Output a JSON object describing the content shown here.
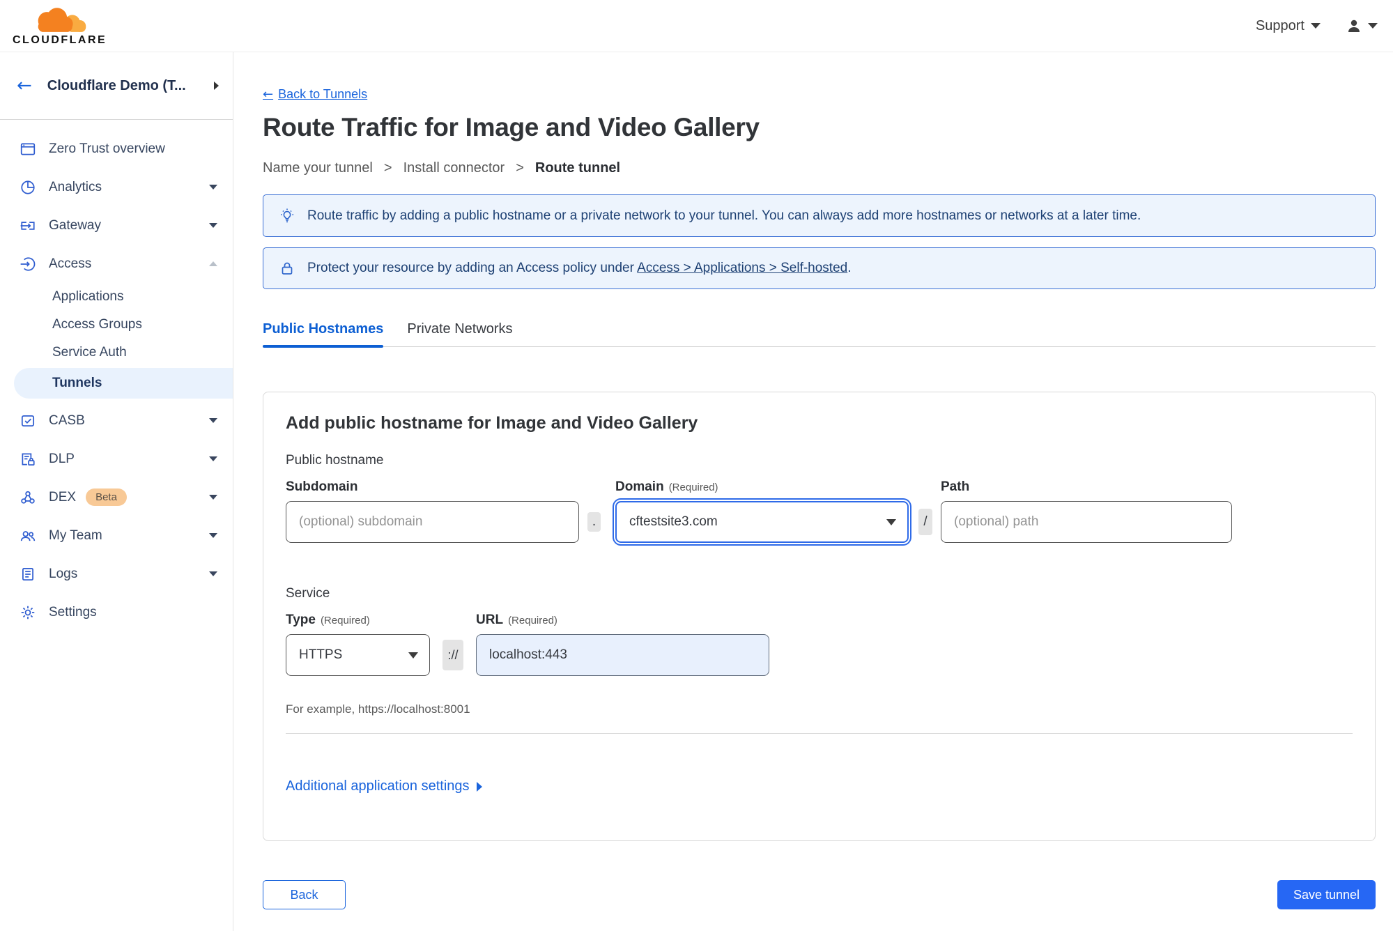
{
  "logo": {
    "brand": "CLOUDFLARE"
  },
  "header": {
    "support_label": "Support"
  },
  "colors": {
    "accent": "#1a64dc",
    "tab_active": "#0d5fd3",
    "save_button": "#2667f4",
    "banner_bg": "#edf4fd",
    "banner_border": "#3c70d5",
    "banner_text": "#1d4073",
    "selected_item_bg": "#e9f2fd",
    "beta_bg": "#f8c996",
    "beta_text": "#5b5147",
    "brand_orange": "#f48120",
    "brand_orange_light": "#f9ab41",
    "url_input_bg": "#e8f0fd"
  },
  "icons": [
    "cloudflare-cloud",
    "person",
    "caret-down",
    "back-arrow",
    "chevron-right",
    "window",
    "pie-chart",
    "gateway",
    "access-arrow",
    "casb-check",
    "dlp-doc-lock",
    "dex-nodes",
    "team",
    "logs-doc",
    "gear",
    "lightbulb",
    "lock"
  ],
  "sidebar": {
    "account": "Cloudflare Demo (T...",
    "items": [
      {
        "label": "Zero Trust overview"
      },
      {
        "label": "Analytics"
      },
      {
        "label": "Gateway"
      },
      {
        "label": "Access"
      },
      {
        "label": "Applications"
      },
      {
        "label": "Access Groups"
      },
      {
        "label": "Service Auth"
      },
      {
        "label": "Tunnels",
        "selected": true
      },
      {
        "label": "CASB"
      },
      {
        "label": "DLP"
      },
      {
        "label": "DEX",
        "badge": "Beta"
      },
      {
        "label": "My Team"
      },
      {
        "label": "Logs"
      },
      {
        "label": "Settings"
      }
    ]
  },
  "main": {
    "back_link": "Back to Tunnels",
    "back_arrow": "←",
    "title": "Route Traffic for Image and Video Gallery",
    "steps": [
      "Name your tunnel",
      "Install connector",
      "Route tunnel"
    ],
    "step_separator": ">",
    "banners": [
      {
        "icon": "lightbulb",
        "text": "Route traffic by adding a public hostname or a private network to your tunnel. You can always add more hostnames or networks at a later time."
      },
      {
        "icon": "lock",
        "text_prefix": "Protect your resource by adding an Access policy under ",
        "link": "Access > Applications > Self-hosted",
        "suffix": "."
      }
    ],
    "tabs": [
      {
        "label": "Public Hostnames",
        "active": true
      },
      {
        "label": "Private Networks",
        "active": false
      }
    ]
  },
  "form": {
    "heading": "Add public hostname for Image and Video Gallery",
    "hostname_section": "Public hostname",
    "subdomain": {
      "label": "Subdomain",
      "placeholder": "(optional) subdomain"
    },
    "domain": {
      "label": "Domain",
      "required": "(Required)",
      "value": "cftestsite3.com"
    },
    "path": {
      "label": "Path",
      "placeholder": "(optional) path"
    },
    "dot_separator": ".",
    "slash_separator": "/",
    "scheme_separator": "://",
    "service_section": "Service",
    "type": {
      "label": "Type",
      "required": "(Required)",
      "value": "HTTPS"
    },
    "url": {
      "label": "URL",
      "required": "(Required)",
      "value": "localhost:443"
    },
    "example": "For example, https://localhost:8001",
    "additional_settings": "Additional application settings"
  },
  "footer": {
    "back": "Back",
    "save": "Save tunnel"
  }
}
